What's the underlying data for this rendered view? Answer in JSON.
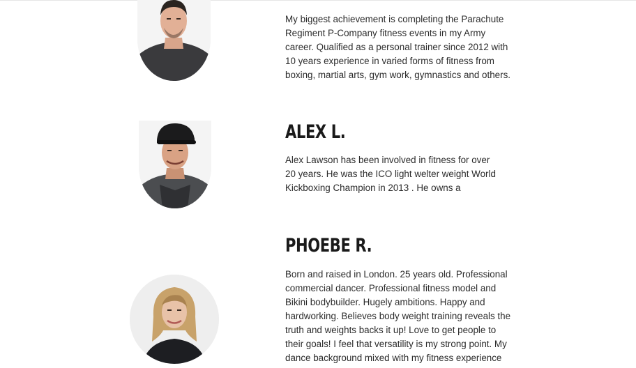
{
  "trainers": [
    {
      "name": "",
      "bio": "My biggest achievement is completing the Parachute Regiment P-Company fitness events in my Army career. Qualified as a personal trainer since 2012 with 10 years experience in varied forms of fitness from boxing, martial arts, gym work, gymnastics and others.",
      "photo_icon": "man-portrait-photo"
    },
    {
      "name": "ALEX L.",
      "bio": "Alex Lawson has been involved in fitness for over 20 years. He was the ICO light welter weight World Kickboxing Champion in 2013 . He owns a",
      "photo_icon": "man-with-cap-portrait-photo"
    },
    {
      "name": "PHOEBE R.",
      "bio": "Born and raised in London. 25 years old. Professional commercial dancer. Professional fitness model and Bikini bodybuilder. Hugely ambitions. Happy and hardworking. Believes body weight training reveals the truth and weights backs it up! Love to get people to their goals! I feel that versatility is my strong point. My dance background mixed with my fitness experience helps me",
      "photo_icon": "woman-portrait-photo"
    }
  ],
  "colors": {
    "background": "#ffffff",
    "text": "#2b2b2b",
    "heading": "#1a1a1a"
  }
}
